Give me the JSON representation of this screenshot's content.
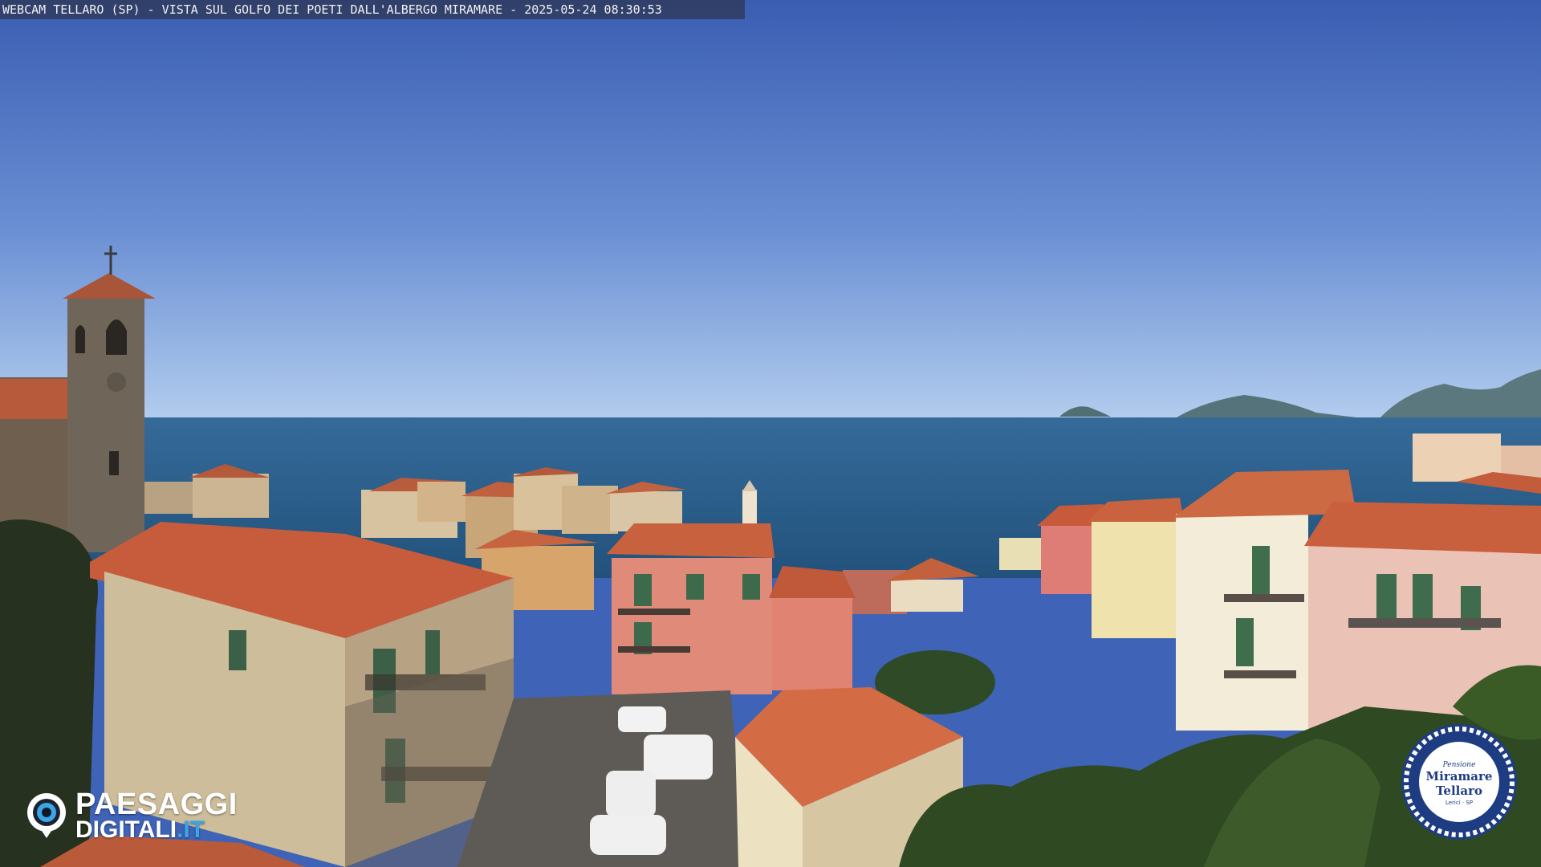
{
  "overlay": {
    "caption": "WEBCAM TELLARO (SP) - VISTA SUL GOLFO DEI POETI DALL'ALBERGO MIRAMARE - 2025-05-24 08:30:53"
  },
  "watermark": {
    "brand_line1": "PAESAGGI",
    "brand_line2_main": "DIGITALI",
    "brand_line2_tld": ".IT",
    "pin_icon": "camera-pin-icon",
    "accent_color": "#3aa6e6"
  },
  "badge": {
    "small_text": "Pensione",
    "name_line1": "Miramare",
    "name_line2": "Tellaro",
    "sub_text": "Lerici · SP",
    "rope_color": "#1e3c82"
  },
  "colors": {
    "sky_top": "#3c5fb3",
    "sky_horizon": "#a9c7ea",
    "sea": "#2c5f8a",
    "roof": "#c8613e"
  }
}
